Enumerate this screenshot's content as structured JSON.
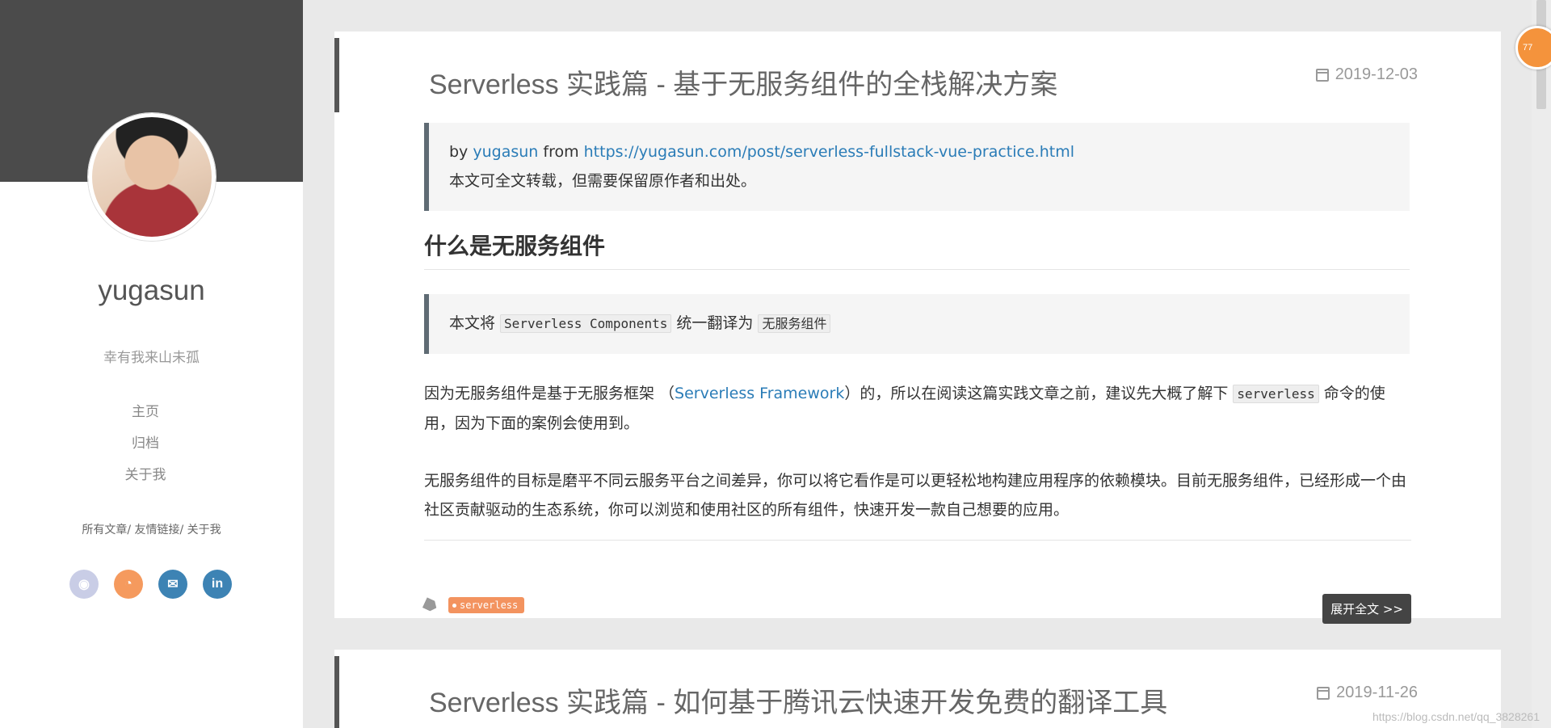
{
  "sidebar": {
    "site_name": "yugasun",
    "motto": "幸有我来山未孤",
    "nav": [
      "主页",
      "归档",
      "关于我"
    ],
    "links": [
      "所有文章",
      "友情链接",
      "关于我"
    ],
    "social": [
      {
        "name": "github-icon",
        "glyph": "◉",
        "color": "#c9cde6"
      },
      {
        "name": "rss-icon",
        "glyph": "◔",
        "color": "#f59a5e"
      },
      {
        "name": "mail-icon",
        "glyph": "✉",
        "color": "#3d83b4"
      },
      {
        "name": "linkedin-icon",
        "glyph": "in",
        "color": "#3d83b4"
      }
    ]
  },
  "posts": [
    {
      "title": "Serverless 实践篇 - 基于无服务组件的全栈解决方案",
      "date": "2019-12-03",
      "quote": {
        "by": "by ",
        "author": "yugasun",
        "from": " from ",
        "url": "https://yugasun.com/post/serverless-fullstack-vue-practice.html",
        "notice": "本文可全文转载，但需要保留原作者和出处。"
      },
      "heading": "什么是无服务组件",
      "note": {
        "pre": "本文将 ",
        "code1": "Serverless Components",
        "mid": " 统一翻译为 ",
        "code2": "无服务组件"
      },
      "para1": {
        "pre": "因为无服务组件是基于无服务框架 （",
        "link": "Serverless Framework",
        "mid": "）的，所以在阅读这篇实践文章之前，建议先大概了解下 ",
        "code": "serverless",
        "post": " 命令的使用，因为下面的案例会使用到。"
      },
      "para2": "无服务组件的目标是磨平不同云服务平台之间差异，你可以将它看作是可以更轻松地构建应用程序的依赖模块。目前无服务组件，已经形成一个由社区贡献驱动的生态系统，你可以浏览和使用社区的所有组件，快速开发一款自己想要的应用。",
      "tag": "serverless",
      "readmore": "展开全文 >>"
    },
    {
      "title": "Serverless 实践篇 - 如何基于腾讯云快速开发免费的翻译工具",
      "date": "2019-11-26"
    }
  ],
  "badge": "77",
  "watermark": "https://blog.csdn.net/qq_3828261"
}
